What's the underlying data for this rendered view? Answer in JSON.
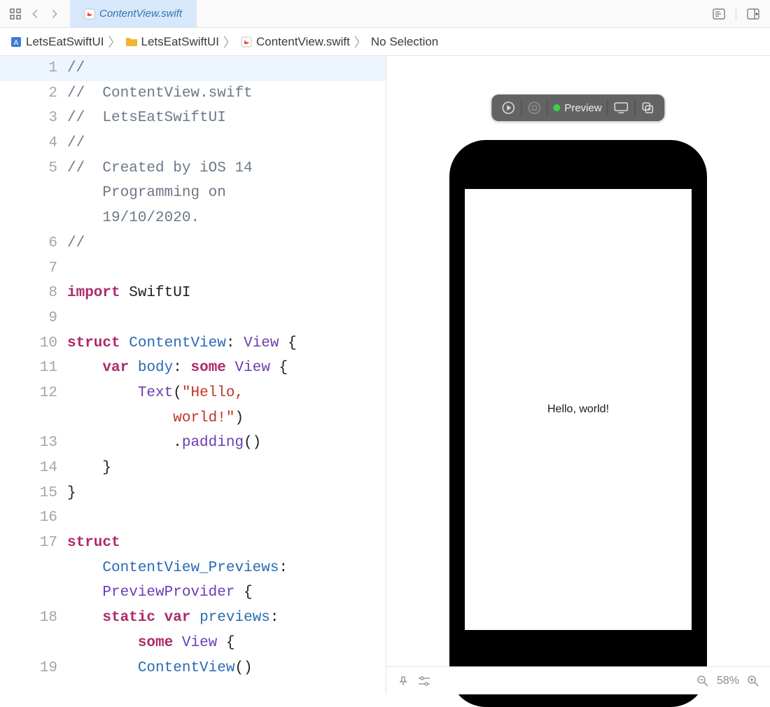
{
  "tab": {
    "title": "ContentView.swift"
  },
  "breadcrumbs": {
    "items": [
      {
        "icon": "project-icon",
        "label": "LetsEatSwiftUI"
      },
      {
        "icon": "folder-icon",
        "label": "LetsEatSwiftUI"
      },
      {
        "icon": "swift-icon",
        "label": "ContentView.swift"
      },
      {
        "icon": "",
        "label": "No Selection"
      }
    ]
  },
  "editor": {
    "lines": [
      {
        "n": 1,
        "hl": true,
        "tokens": [
          {
            "cls": "tok-comment",
            "t": "//"
          }
        ]
      },
      {
        "n": 2,
        "tokens": [
          {
            "cls": "tok-comment",
            "t": "//  ContentView.swift"
          }
        ]
      },
      {
        "n": 3,
        "tokens": [
          {
            "cls": "tok-comment",
            "t": "//  LetsEatSwiftUI"
          }
        ]
      },
      {
        "n": 4,
        "tokens": [
          {
            "cls": "tok-comment",
            "t": "//"
          }
        ]
      },
      {
        "n": 5,
        "tokens": [
          {
            "cls": "tok-comment",
            "t": "//  Created by iOS 14 "
          }
        ]
      },
      {
        "n": "",
        "tokens": [
          {
            "cls": "tok-comment",
            "t": "    Programming on "
          }
        ]
      },
      {
        "n": "",
        "tokens": [
          {
            "cls": "tok-comment",
            "t": "    19/10/2020."
          }
        ]
      },
      {
        "n": 6,
        "tokens": [
          {
            "cls": "tok-comment",
            "t": "//"
          }
        ]
      },
      {
        "n": 7,
        "tokens": [
          {
            "cls": "tok-plain",
            "t": ""
          }
        ]
      },
      {
        "n": 8,
        "tokens": [
          {
            "cls": "tok-keyword",
            "t": "import"
          },
          {
            "cls": "tok-plain",
            "t": " SwiftUI"
          }
        ]
      },
      {
        "n": 9,
        "tokens": [
          {
            "cls": "tok-plain",
            "t": ""
          }
        ]
      },
      {
        "n": 10,
        "tokens": [
          {
            "cls": "tok-keyword",
            "t": "struct"
          },
          {
            "cls": "tok-plain",
            "t": " "
          },
          {
            "cls": "tok-ident",
            "t": "ContentView"
          },
          {
            "cls": "tok-plain",
            "t": ": "
          },
          {
            "cls": "tok-purple",
            "t": "View"
          },
          {
            "cls": "tok-plain",
            "t": " {"
          }
        ]
      },
      {
        "n": 11,
        "tokens": [
          {
            "cls": "tok-plain",
            "t": "    "
          },
          {
            "cls": "tok-keyword",
            "t": "var"
          },
          {
            "cls": "tok-plain",
            "t": " "
          },
          {
            "cls": "tok-ident",
            "t": "body"
          },
          {
            "cls": "tok-plain",
            "t": ": "
          },
          {
            "cls": "tok-keyword",
            "t": "some"
          },
          {
            "cls": "tok-plain",
            "t": " "
          },
          {
            "cls": "tok-purple",
            "t": "View"
          },
          {
            "cls": "tok-plain",
            "t": " {"
          }
        ]
      },
      {
        "n": 12,
        "tokens": [
          {
            "cls": "tok-plain",
            "t": "        "
          },
          {
            "cls": "tok-purple",
            "t": "Text"
          },
          {
            "cls": "tok-plain",
            "t": "("
          },
          {
            "cls": "tok-string",
            "t": "\"Hello, "
          }
        ]
      },
      {
        "n": "",
        "tokens": [
          {
            "cls": "tok-plain",
            "t": "            "
          },
          {
            "cls": "tok-string",
            "t": "world!\""
          },
          {
            "cls": "tok-plain",
            "t": ")"
          }
        ]
      },
      {
        "n": 13,
        "tokens": [
          {
            "cls": "tok-plain",
            "t": "            ."
          },
          {
            "cls": "tok-purple",
            "t": "padding"
          },
          {
            "cls": "tok-plain",
            "t": "()"
          }
        ]
      },
      {
        "n": 14,
        "tokens": [
          {
            "cls": "tok-plain",
            "t": "    }"
          }
        ]
      },
      {
        "n": 15,
        "tokens": [
          {
            "cls": "tok-plain",
            "t": "}"
          }
        ]
      },
      {
        "n": 16,
        "tokens": [
          {
            "cls": "tok-plain",
            "t": ""
          }
        ]
      },
      {
        "n": 17,
        "tokens": [
          {
            "cls": "tok-keyword",
            "t": "struct"
          }
        ]
      },
      {
        "n": "",
        "tokens": [
          {
            "cls": "tok-plain",
            "t": "    "
          },
          {
            "cls": "tok-ident",
            "t": "ContentView_Previews"
          },
          {
            "cls": "tok-plain",
            "t": ":"
          }
        ]
      },
      {
        "n": "",
        "tokens": [
          {
            "cls": "tok-plain",
            "t": "    "
          },
          {
            "cls": "tok-purple",
            "t": "PreviewProvider"
          },
          {
            "cls": "tok-plain",
            "t": " {"
          }
        ]
      },
      {
        "n": 18,
        "tokens": [
          {
            "cls": "tok-plain",
            "t": "    "
          },
          {
            "cls": "tok-keyword",
            "t": "static"
          },
          {
            "cls": "tok-plain",
            "t": " "
          },
          {
            "cls": "tok-keyword",
            "t": "var"
          },
          {
            "cls": "tok-plain",
            "t": " "
          },
          {
            "cls": "tok-ident",
            "t": "previews"
          },
          {
            "cls": "tok-plain",
            "t": ":"
          }
        ]
      },
      {
        "n": "",
        "tokens": [
          {
            "cls": "tok-plain",
            "t": "        "
          },
          {
            "cls": "tok-keyword",
            "t": "some"
          },
          {
            "cls": "tok-plain",
            "t": " "
          },
          {
            "cls": "tok-purple",
            "t": "View"
          },
          {
            "cls": "tok-plain",
            "t": " {"
          }
        ]
      },
      {
        "n": 19,
        "tokens": [
          {
            "cls": "tok-plain",
            "t": "        "
          },
          {
            "cls": "tok-ident",
            "t": "ContentView"
          },
          {
            "cls": "tok-plain",
            "t": "()"
          }
        ]
      }
    ]
  },
  "canvas": {
    "preview_label": "Preview",
    "device_text": "Hello, world!",
    "zoom_label": "58%"
  }
}
